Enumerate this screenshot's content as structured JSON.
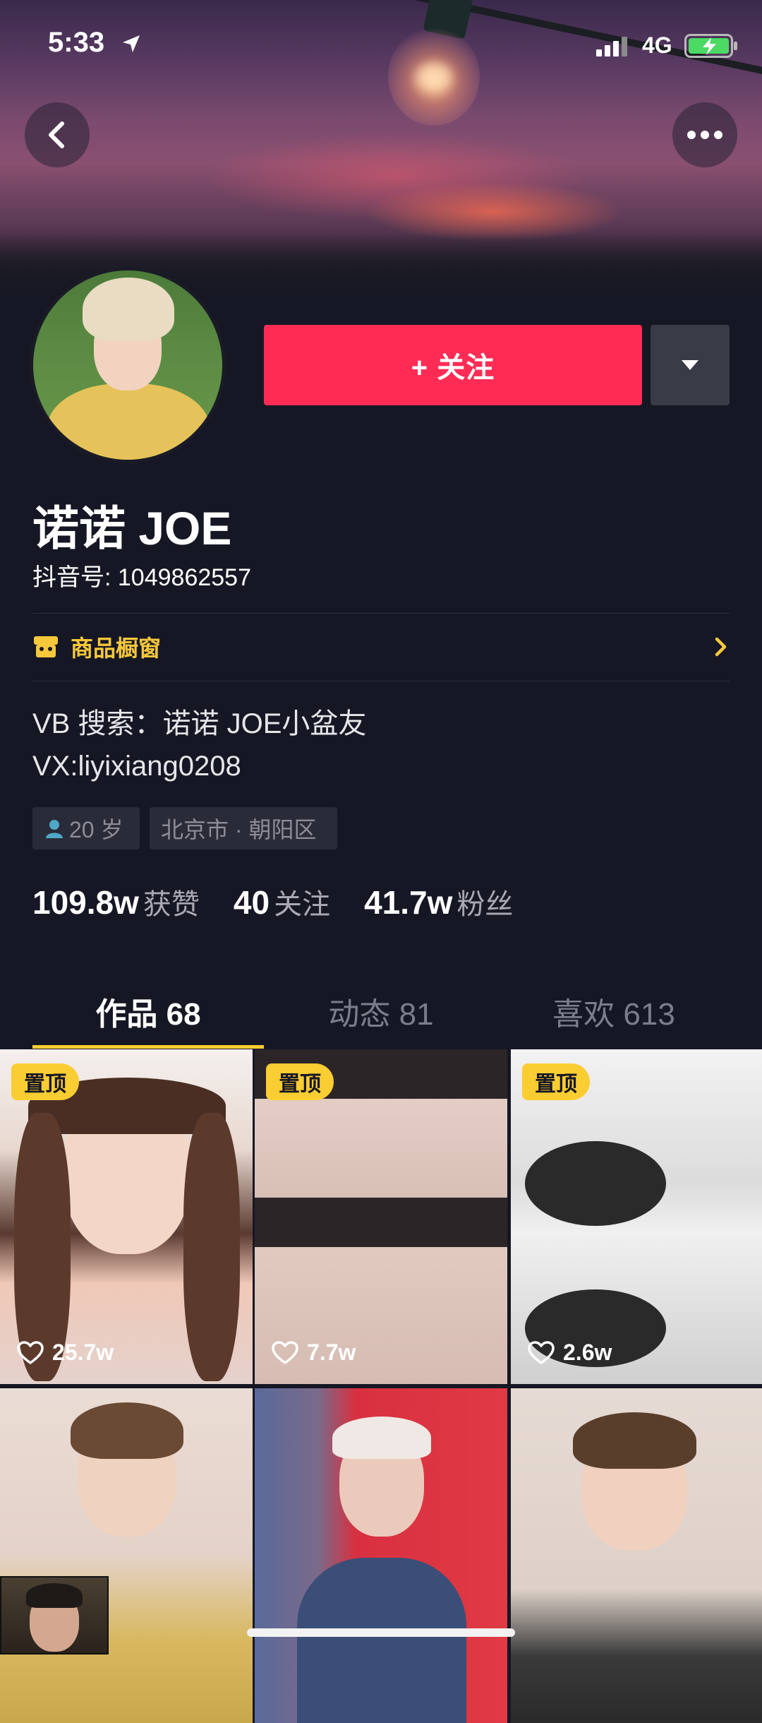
{
  "status_bar": {
    "time": "5:33",
    "network": "4G"
  },
  "profile": {
    "follow_label": "+ 关注",
    "name": "诺诺 JOE",
    "douyin_id": "抖音号: 1049862557",
    "shop_label": "商品橱窗",
    "bio_lines": [
      "VB 搜索：诺诺 JOE小盆友",
      "VX:liyixiang0208"
    ],
    "tags": {
      "age": "20 岁",
      "location": "北京市 · 朝阳区"
    },
    "stats": {
      "likes_value": "109.8w",
      "likes_label": "获赞",
      "following_value": "40",
      "following_label": "关注",
      "followers_value": "41.7w",
      "followers_label": "粉丝"
    }
  },
  "tabs": [
    {
      "label": "作品 68",
      "active": true
    },
    {
      "label": "动态 81",
      "active": false
    },
    {
      "label": "喜欢 613",
      "active": false
    }
  ],
  "grid": {
    "pinned_label": "置顶",
    "items": [
      {
        "likes": "25.7w",
        "pinned": true
      },
      {
        "likes": "7.7w",
        "pinned": true
      },
      {
        "likes": "2.6w",
        "pinned": true
      },
      {
        "likes": "",
        "pinned": false
      },
      {
        "likes": "",
        "pinned": false
      },
      {
        "likes": "",
        "pinned": false
      }
    ]
  },
  "colors": {
    "background": "#161724",
    "follow_button": "#fe2c55",
    "accent_yellow": "#facd32",
    "shop_text": "#f7c83c"
  }
}
